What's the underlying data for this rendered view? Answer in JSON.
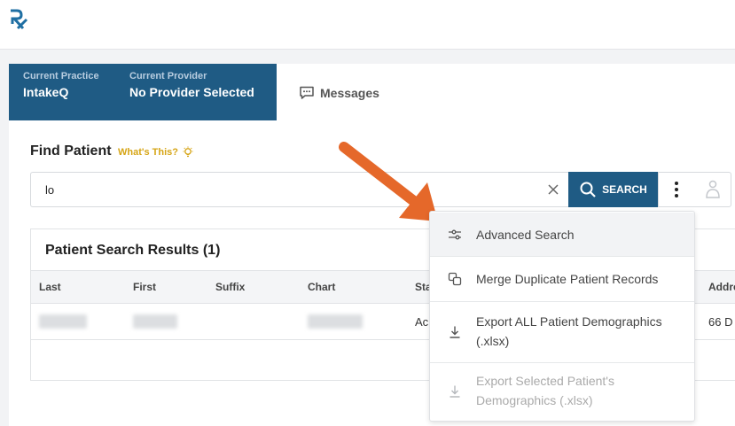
{
  "logo": {
    "text": "Rx"
  },
  "context": {
    "practice_label": "Current Practice",
    "practice_value": "IntakeQ",
    "provider_label": "Current Provider",
    "provider_value": "No Provider Selected",
    "messages_label": "Messages"
  },
  "find": {
    "title": "Find Patient",
    "whats_this": "What's This?",
    "search_value": "lo",
    "search_button": "SEARCH"
  },
  "results": {
    "title": "Patient Search Results (1)",
    "columns": [
      "Last",
      "First",
      "Suffix",
      "Chart",
      "Sta",
      "Addre"
    ],
    "row": {
      "status": "Ac",
      "address": "66 D"
    }
  },
  "menu": {
    "items": [
      {
        "label": "Advanced Search",
        "icon": "sliders-icon",
        "state": "hover"
      },
      {
        "label": "Merge Duplicate Patient Records",
        "icon": "copy-icon",
        "state": "normal"
      },
      {
        "label": "Export ALL Patient Demographics (.xlsx)",
        "icon": "download-icon",
        "state": "normal"
      },
      {
        "label": "Export Selected Patient's Demographics (.xlsx)",
        "icon": "download-icon",
        "state": "disabled"
      }
    ]
  },
  "colors": {
    "brand": "#1f5b84",
    "accent": "#e5682a",
    "hint": "#d6a516"
  }
}
